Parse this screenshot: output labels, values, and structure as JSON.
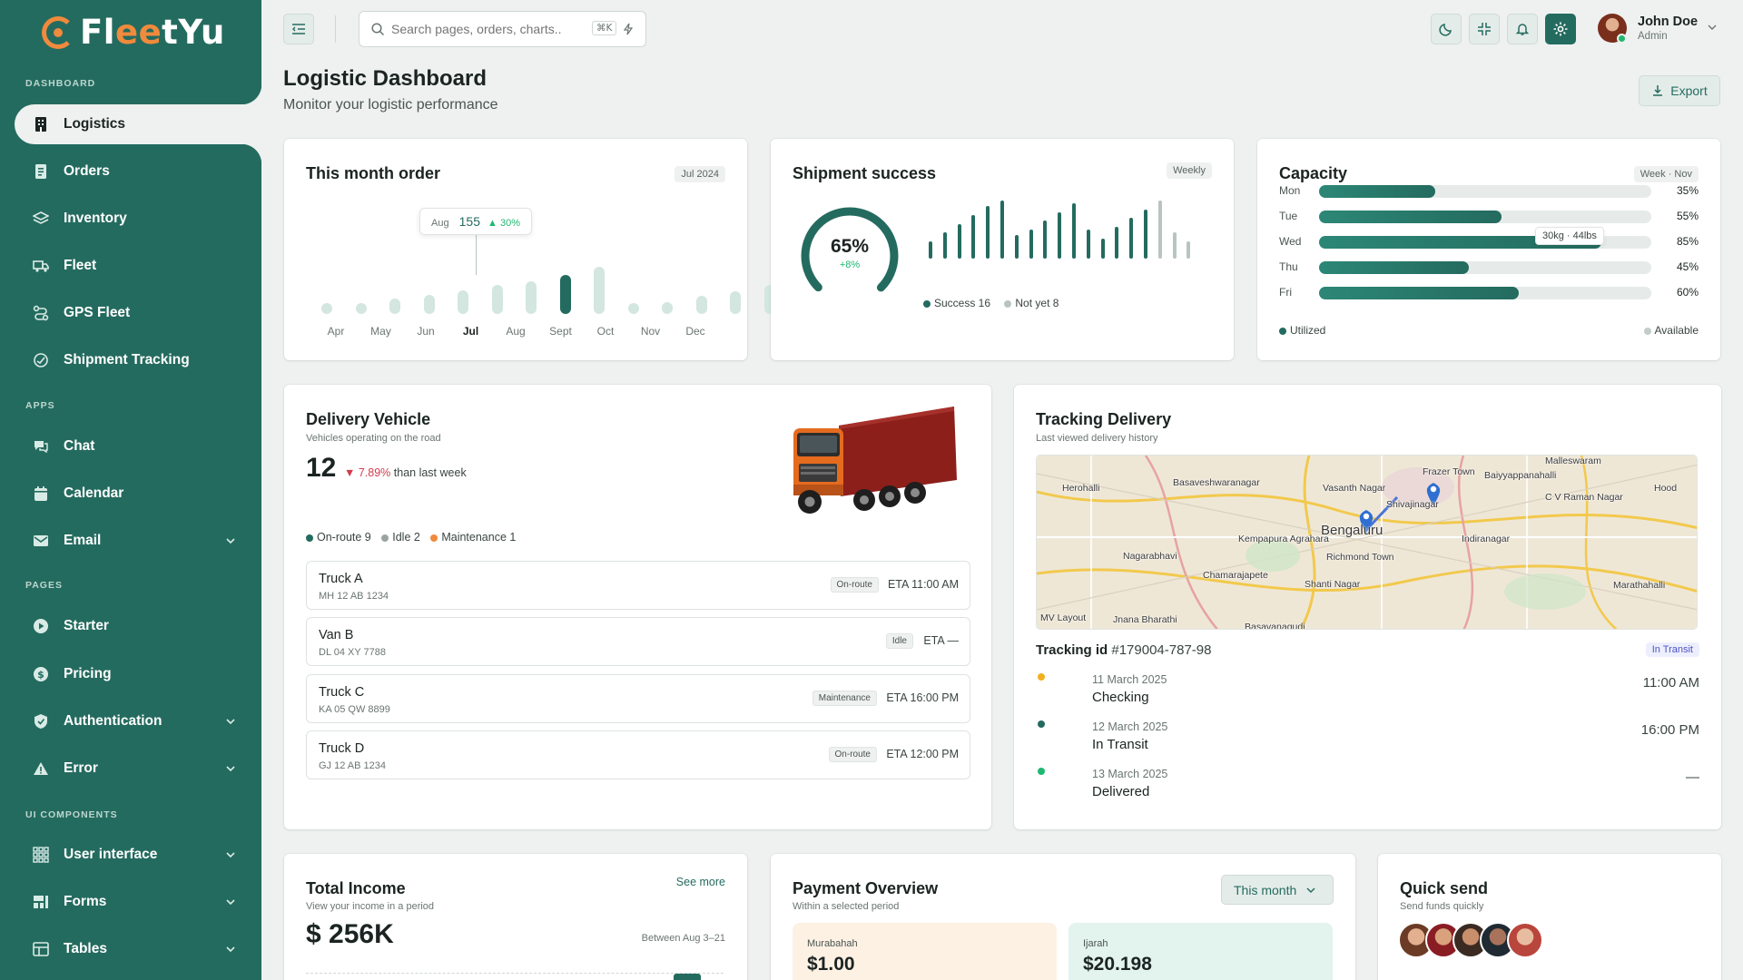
{
  "brand": {
    "prefix": "Fl",
    "ee": "ee",
    "suffix": "tYu"
  },
  "sidebar": {
    "sections": [
      "DASHBOARD",
      "APPS",
      "PAGES",
      "UI COMPONENTS"
    ],
    "items": [
      {
        "label": "Logistics",
        "icon": "building-icon"
      },
      {
        "label": "Orders",
        "icon": "receipt-icon"
      },
      {
        "label": "Inventory",
        "icon": "layers-icon"
      },
      {
        "label": "Fleet",
        "icon": "truck-icon"
      },
      {
        "label": "GPS Fleet",
        "icon": "route-icon"
      },
      {
        "label": "Shipment Tracking",
        "icon": "tracking-icon"
      },
      {
        "label": "Chat",
        "icon": "chat-icon"
      },
      {
        "label": "Calendar",
        "icon": "calendar-icon"
      },
      {
        "label": "Email",
        "icon": "mail-icon"
      },
      {
        "label": "Starter",
        "icon": "play-icon"
      },
      {
        "label": "Pricing",
        "icon": "dollar-icon"
      },
      {
        "label": "Authentication",
        "icon": "shield-icon"
      },
      {
        "label": "Error",
        "icon": "warning-icon"
      },
      {
        "label": "User interface",
        "icon": "grid-icon"
      },
      {
        "label": "Forms",
        "icon": "form-icon"
      },
      {
        "label": "Tables",
        "icon": "table-icon"
      }
    ]
  },
  "topbar": {
    "search_placeholder": "Search pages, orders, charts..",
    "shortcut": "⌘K",
    "user_name": "John Doe",
    "user_role": "Admin"
  },
  "page": {
    "title": "Logistic Dashboard",
    "subtitle": "Monitor your logistic performance",
    "export_label": "Export"
  },
  "month_order": {
    "title": "This month order",
    "badge": "Jul 2024",
    "tooltip": {
      "month": "Aug",
      "value": "155",
      "change": "▲ 30%"
    },
    "chart_data": {
      "type": "bar",
      "categories": [
        "Apr",
        "May",
        "Jun",
        "Jul",
        "Aug",
        "Sept",
        "Oct",
        "Nov",
        "Dec"
      ],
      "values": [
        0.08,
        0.22,
        0.32,
        0.4,
        0.5,
        0.62,
        0.7,
        0.82,
        1.0,
        0.1,
        0.25,
        0.38,
        0.48,
        0.62,
        0.3,
        0.1
      ]
    }
  },
  "shipment": {
    "title": "Shipment success",
    "badge": "Weekly",
    "pct": "65%",
    "delta": "+8%",
    "legend": [
      {
        "label": "Success 16",
        "color": "#246b5f"
      },
      {
        "label": "Not yet 8",
        "color": "#b8c4c1"
      }
    ],
    "chart_data": {
      "type": "bar",
      "series": [
        {
          "name": "Success",
          "values": [
            0.3,
            0.45,
            0.6,
            0.75,
            0.9,
            1.0,
            0.4,
            0.5,
            0.65,
            0.8,
            0.95,
            0.5,
            0.35,
            0.55,
            0.7,
            0.85
          ]
        },
        {
          "name": "Not yet",
          "values": [
            1.0,
            0.45,
            0.3
          ]
        }
      ]
    }
  },
  "capacity": {
    "title": "Capacity",
    "badge": "Week · Nov",
    "tooltip": "30kg · 44lbs",
    "legend_left": "Utilized",
    "legend_right": "Available",
    "chart_data": {
      "type": "bar",
      "categories": [
        "Mon",
        "Tue",
        "Wed",
        "Thu",
        "Fri"
      ],
      "values": [
        35,
        55,
        85,
        45,
        60
      ],
      "labels": [
        "35%",
        "55%",
        "85%",
        "45%",
        "60%"
      ]
    }
  },
  "vehicles": {
    "title": "Delivery Vehicle",
    "subtitle": "Vehicles operating on the road",
    "count": "12",
    "change": "▼ 7.89%",
    "change_text": "than last week",
    "legend": [
      {
        "label": "On-route 9",
        "color": "#246b5f"
      },
      {
        "label": "Idle 2",
        "color": "#9aa5a2"
      },
      {
        "label": "Maintenance 1",
        "color": "#f08a3c"
      }
    ],
    "rows": [
      {
        "name": "Truck A",
        "plate": "MH 12 AB 1234",
        "status": "On-route",
        "eta": "ETA 11:00 AM"
      },
      {
        "name": "Van B",
        "plate": "DL 04 XY 7788",
        "status": "Idle",
        "eta": "ETA —"
      },
      {
        "name": "Truck C",
        "plate": "KA 05 QW 8899",
        "status": "Maintenance",
        "eta": "ETA 16:00 PM"
      },
      {
        "name": "Truck D",
        "plate": "GJ 12 AB 1234",
        "status": "On-route",
        "eta": "ETA 12:00 PM"
      }
    ]
  },
  "tracking": {
    "title": "Tracking Delivery",
    "subtitle": "Last viewed delivery history",
    "id_label": "Tracking id",
    "id_value": "#179004-787-98",
    "badge": "In Transit",
    "map_labels": [
      "Malleswaram",
      "Herohalli",
      "Basaveshwaranagar",
      "Vasanth Nagar",
      "Frazer Town",
      "Shivajinagar",
      "Baiyyappanahalli",
      "Hood",
      "C V Raman Nagar",
      "Bengaluru",
      "Kempapura Agrahara",
      "Richmond Town",
      "Indiranagar",
      "Nagarabhavi",
      "Chamarajapete",
      "Shanti Nagar",
      "Marathahalli",
      "MV Layout",
      "Jnana Bharathi",
      "Basavanagudi"
    ],
    "timeline": [
      {
        "date": "11 March 2025",
        "status": "Checking",
        "time": "11:00 AM",
        "color": "#f2b01e"
      },
      {
        "date": "12 March 2025",
        "status": "In Transit",
        "time": "16:00 PM",
        "color": "#246b5f"
      },
      {
        "date": "13 March 2025",
        "status": "Delivered",
        "time": "—",
        "color": "#1fb870"
      }
    ]
  },
  "income": {
    "title": "Total Income",
    "subtitle": "View your income in a period",
    "see_more": "See more",
    "value": "$ 256K",
    "period": "Between Aug 3–21"
  },
  "payment": {
    "title": "Payment Overview",
    "subtitle": "Within a selected period",
    "select": "This month",
    "boxes": [
      {
        "label": "Murabahah",
        "value": "$1.00",
        "bg": "#fdf1e4"
      },
      {
        "label": "Ijarah",
        "value": "$20.198",
        "bg": "#e3f3ee"
      }
    ]
  },
  "quick_send": {
    "title": "Quick send",
    "subtitle": "Send funds quickly"
  }
}
